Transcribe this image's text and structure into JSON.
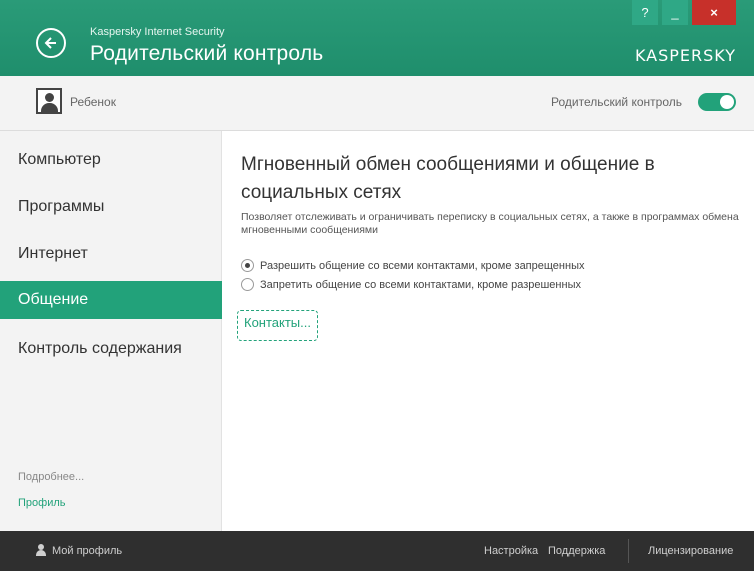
{
  "window": {
    "app_name": "Kaspersky Internet Security",
    "title": "Родительский контроль",
    "brand": "KASPERSKY",
    "help_label": "?",
    "minimize_label": "_",
    "close_label": "×"
  },
  "childbar": {
    "child_name": "Ребенок",
    "parental_control_label": "Родительский контроль",
    "toggle_on": true
  },
  "sidebar": {
    "items": [
      {
        "label": "Компьютер"
      },
      {
        "label": "Программы"
      },
      {
        "label": "Интернет"
      },
      {
        "label": "Общение",
        "active": true
      },
      {
        "label": "Контроль содержания"
      }
    ],
    "more_link": "Подробнее...",
    "profile_link": "Профиль"
  },
  "main": {
    "heading": "Мгновенный обмен сообщениями и общение в социальных сетях",
    "description": "Позволяет отслеживать и ограничивать переписку в социальных сетях, а также в программах обмена мгновенными сообщениями",
    "options": [
      {
        "label": "Разрешить общение со всеми контактами, кроме запрещенных",
        "checked": true
      },
      {
        "label": "Запретить общение со всеми контактами, кроме разрешенных",
        "checked": false
      }
    ],
    "contacts_link": "Контакты..."
  },
  "bottombar": {
    "my_profile": "Мой профиль",
    "settings": "Настройка",
    "support": "Поддержка",
    "licensing": "Лицензирование"
  },
  "colors": {
    "accent": "#22a27a",
    "titlebar": "#1f8e6c",
    "bottombar": "#2f2f2f",
    "close": "#c7302a"
  }
}
